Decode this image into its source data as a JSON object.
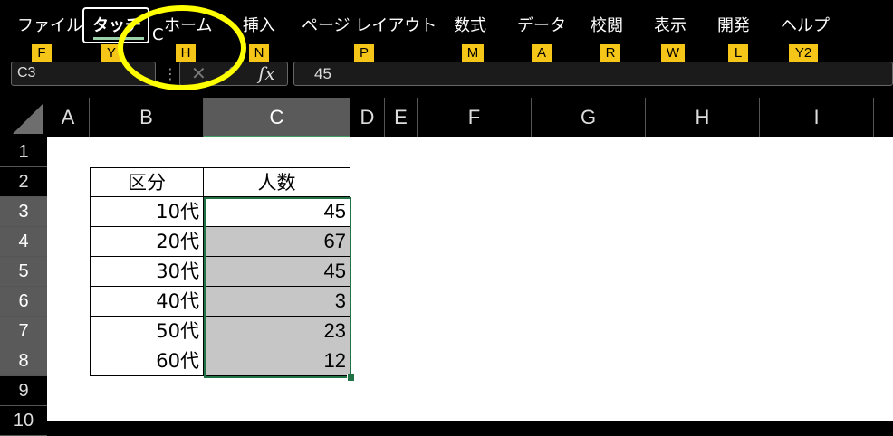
{
  "ribbon": {
    "tabs": [
      {
        "label": "ファイル",
        "key": "F"
      },
      {
        "label": "タッチ",
        "key": "Y"
      },
      {
        "label": "ホーム",
        "key": "H"
      },
      {
        "label": "挿入",
        "key": "N"
      },
      {
        "label": "ページ レイアウト",
        "key": "P"
      },
      {
        "label": "数式",
        "key": "M"
      },
      {
        "label": "データ",
        "key": "A"
      },
      {
        "label": "校閲",
        "key": "R"
      },
      {
        "label": "表示",
        "key": "W"
      },
      {
        "label": "開発",
        "key": "L"
      },
      {
        "label": "ヘルプ",
        "key": "Y2"
      }
    ],
    "stray_char": "C",
    "highlight_color": "#ffff00"
  },
  "formula_bar": {
    "name_box": "C3",
    "fx_label": "fx",
    "value": "45"
  },
  "grid": {
    "columns": [
      "A",
      "B",
      "C",
      "D",
      "E",
      "F",
      "G",
      "H",
      "I"
    ],
    "rows": [
      "1",
      "2",
      "3",
      "4",
      "5",
      "6",
      "7",
      "8",
      "9",
      "10"
    ],
    "selected_column": "C",
    "selected_rows": [
      "3",
      "4",
      "5",
      "6",
      "7",
      "8"
    ]
  },
  "table": {
    "headers": [
      "区分",
      "人数"
    ],
    "rows": [
      {
        "label": "10代",
        "value": "45"
      },
      {
        "label": "20代",
        "value": "67"
      },
      {
        "label": "30代",
        "value": "45"
      },
      {
        "label": "40代",
        "value": "3"
      },
      {
        "label": "50代",
        "value": "23"
      },
      {
        "label": "60代",
        "value": "12"
      }
    ]
  },
  "colors": {
    "selection_border": "#217346",
    "selection_fill": "#c6c6c6"
  }
}
